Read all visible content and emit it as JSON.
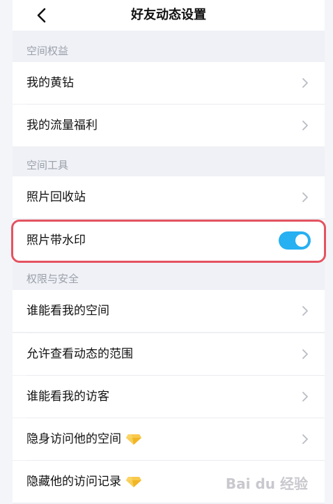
{
  "header": {
    "title": "好友动态设置"
  },
  "sections": [
    {
      "label": "空间权益"
    },
    {
      "label": "空间工具"
    },
    {
      "label": "权限与安全"
    }
  ],
  "items": [
    {
      "label": "我的黄钻"
    },
    {
      "label": "我的流量福利"
    },
    {
      "label": "照片回收站"
    },
    {
      "label": "照片带水印",
      "toggle": true,
      "toggle_on": true
    },
    {
      "label": "谁能看我的空间"
    },
    {
      "label": "允许查看动态的范围"
    },
    {
      "label": "谁能看我的访客"
    },
    {
      "label": "隐身访问他的空间",
      "badge_icon": "diamond-icon"
    },
    {
      "label": "隐藏他的访问记录",
      "badge_icon": "diamond-icon"
    }
  ],
  "watermark": {
    "text": "Bai du 经验"
  },
  "colors": {
    "accent": "#27b0f2",
    "highlight": "#e45360",
    "gem": "#f2b526"
  }
}
